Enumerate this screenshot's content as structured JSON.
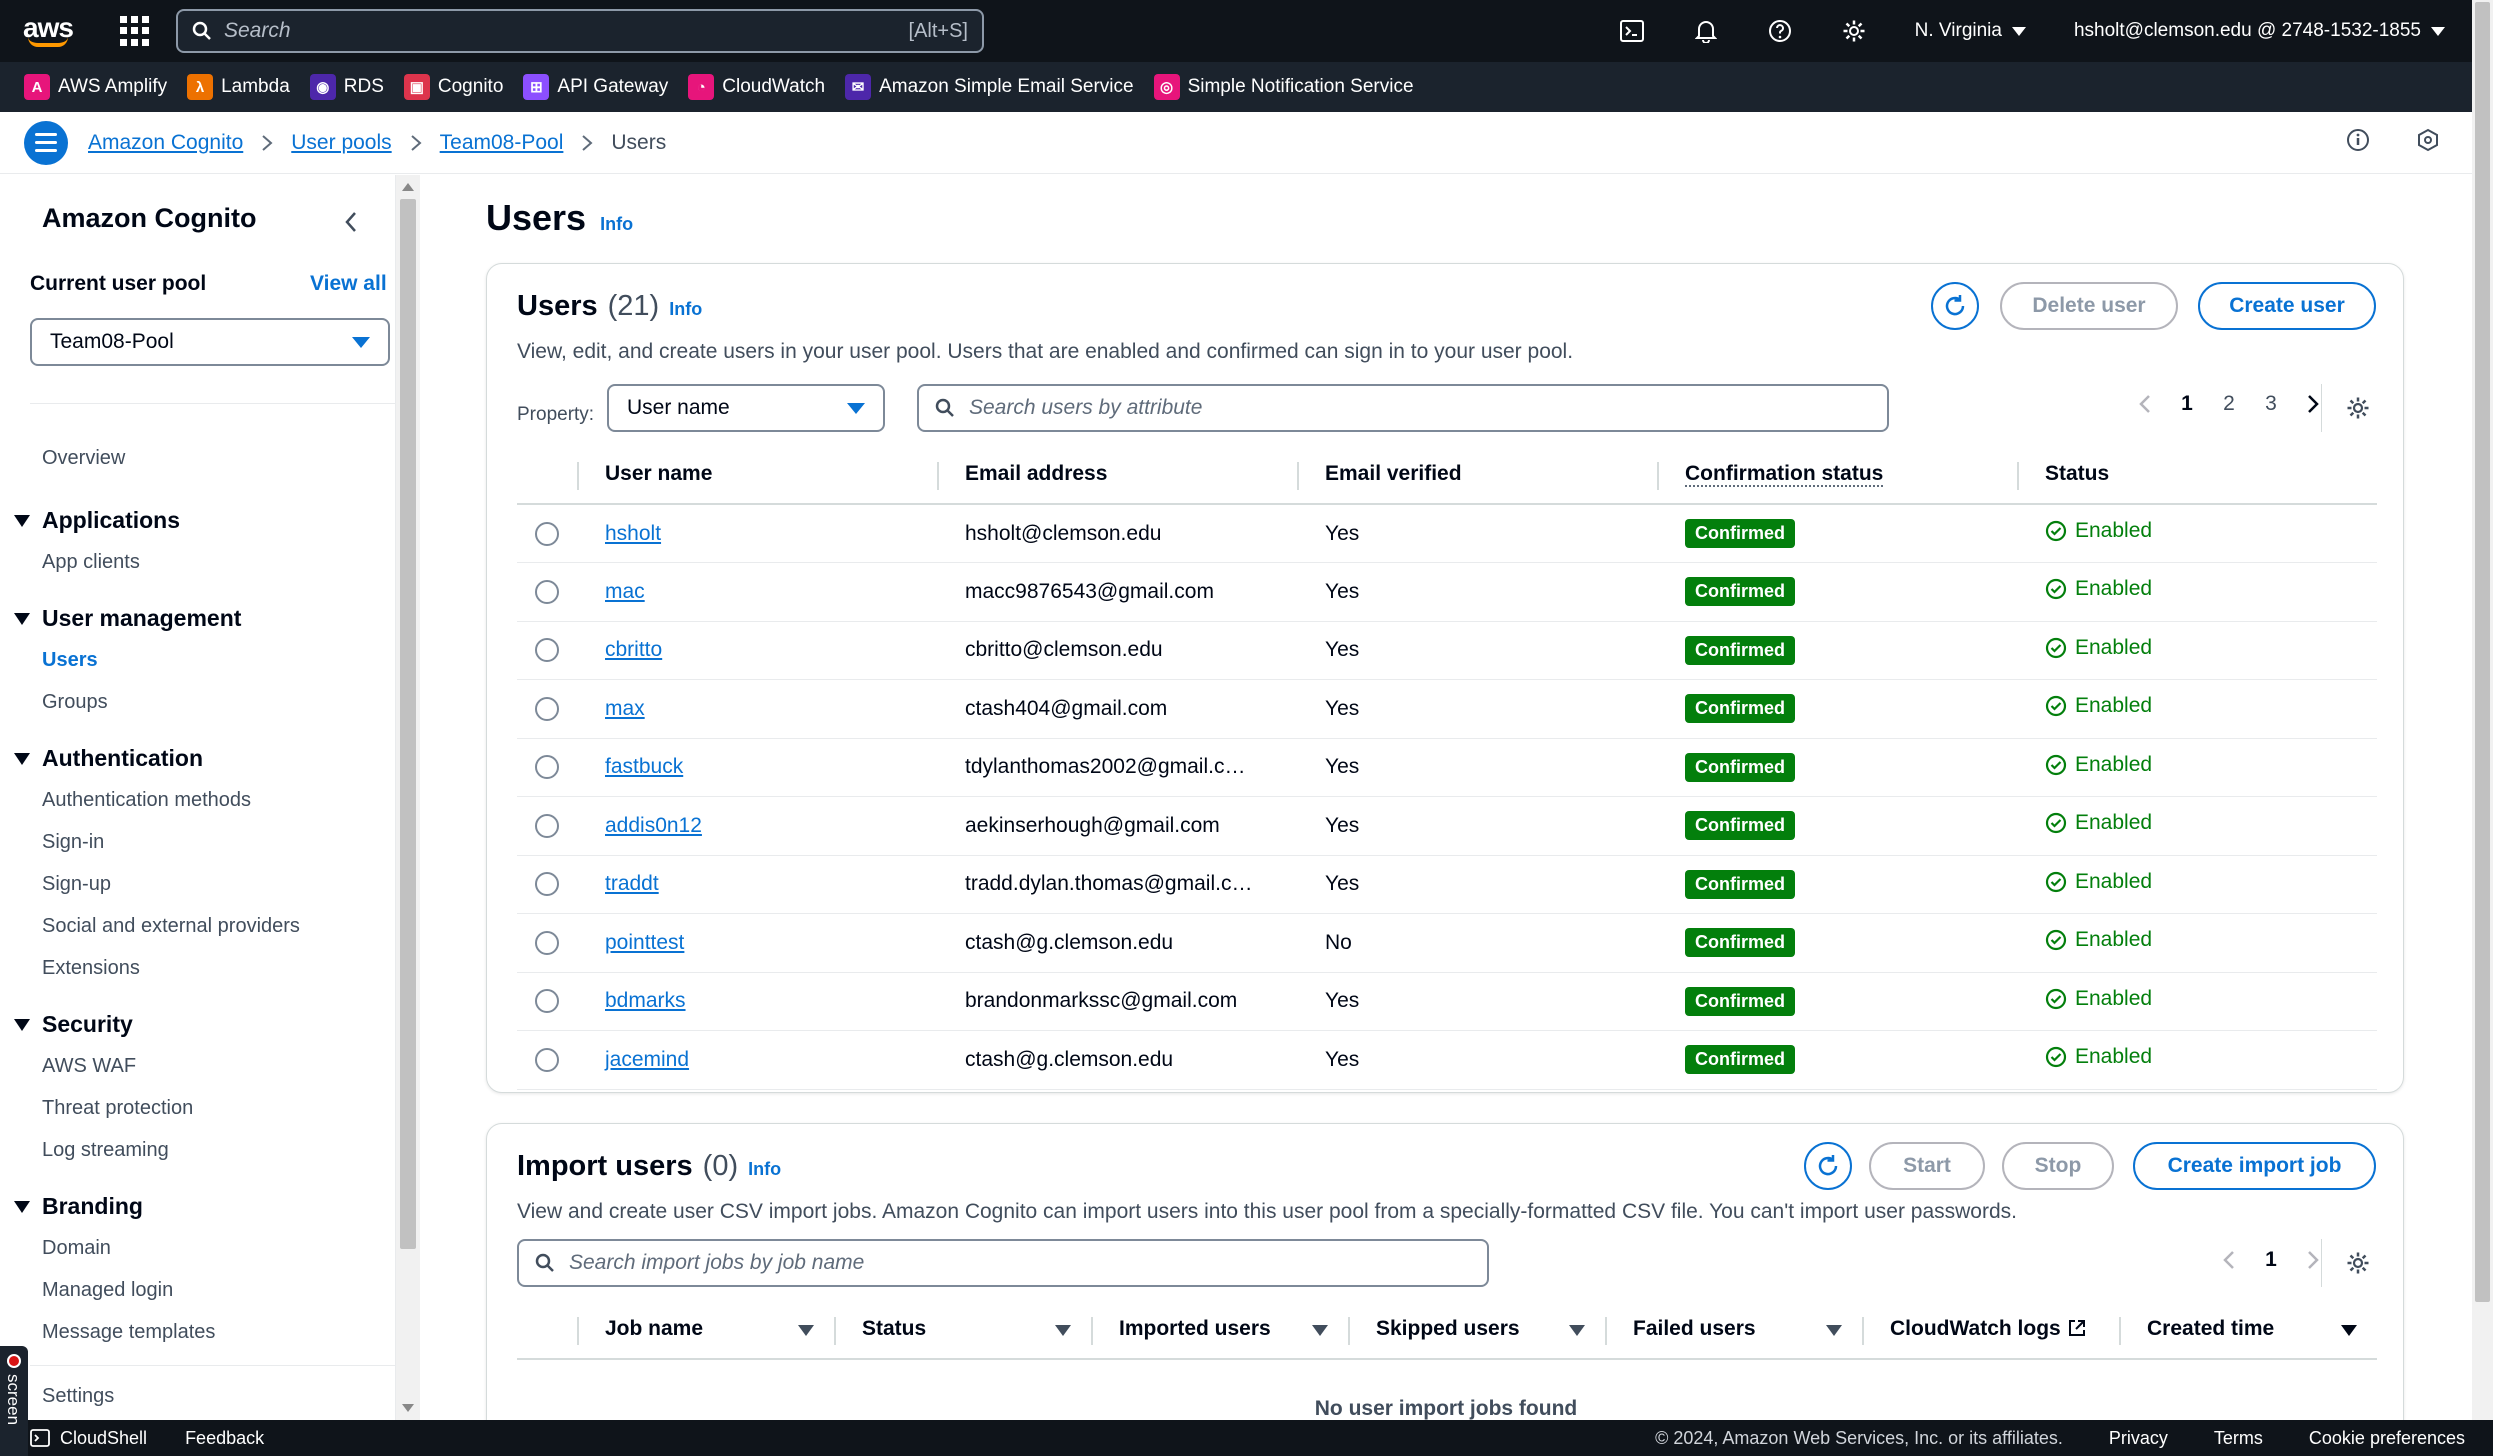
{
  "topnav": {
    "logo": "aws",
    "search_placeholder": "Search",
    "search_shortcut": "[Alt+S]",
    "region": "N. Virginia",
    "account": "hsholt@clemson.edu @ 2748-1532-1855",
    "icons": [
      "cloudshell-icon",
      "bell-icon",
      "help-icon",
      "gear-icon"
    ]
  },
  "favorites": [
    {
      "label": "AWS Amplify",
      "color": "#e7157b",
      "glyph": "A"
    },
    {
      "label": "Lambda",
      "color": "#ed7100",
      "glyph": "λ"
    },
    {
      "label": "RDS",
      "color": "#4d27aa",
      "glyph": "◉"
    },
    {
      "label": "Cognito",
      "color": "#dd344c",
      "glyph": "▣"
    },
    {
      "label": "API Gateway",
      "color": "#8c4fff",
      "glyph": "⊞"
    },
    {
      "label": "CloudWatch",
      "color": "#e7157b",
      "glyph": "◔"
    },
    {
      "label": "Amazon Simple Email Service",
      "color": "#4d27aa",
      "glyph": "✉"
    },
    {
      "label": "Simple Notification Service",
      "color": "#e7157b",
      "glyph": "◎"
    }
  ],
  "breadcrumbs": {
    "items": [
      "Amazon Cognito",
      "User pools",
      "Team08-Pool"
    ],
    "current": "Users"
  },
  "sidebar": {
    "title": "Amazon Cognito",
    "current_pool_label": "Current user pool",
    "view_all": "View all",
    "pool_value": "Team08-Pool",
    "overview": "Overview",
    "sections": [
      {
        "title": "Applications",
        "items": [
          "App clients"
        ]
      },
      {
        "title": "User management",
        "items": [
          "Users",
          "Groups"
        ]
      },
      {
        "title": "Authentication",
        "items": [
          "Authentication methods",
          "Sign-in",
          "Sign-up",
          "Social and external providers",
          "Extensions"
        ]
      },
      {
        "title": "Security",
        "items": [
          "AWS WAF",
          "Threat protection",
          "Log streaming"
        ]
      },
      {
        "title": "Branding",
        "items": [
          "Domain",
          "Managed login",
          "Message templates"
        ]
      }
    ],
    "settings": "Settings"
  },
  "main": {
    "page_title": "Users",
    "info": "Info",
    "users_card": {
      "title": "Users",
      "count": "(21)",
      "info": "Info",
      "description": "View, edit, and create users in your user pool. Users that are enabled and confirmed can sign in to your user pool.",
      "delete_label": "Delete user",
      "create_label": "Create user",
      "property_label": "Property:",
      "property_value": "User name",
      "search_placeholder": "Search users by attribute",
      "pages": [
        "1",
        "2",
        "3"
      ],
      "columns": [
        "User name",
        "Email address",
        "Email verified",
        "Confirmation status",
        "Status"
      ],
      "rows": [
        {
          "username": "hsholt",
          "email": "hsholt@clemson.edu",
          "verified": "Yes",
          "confirmation": "Confirmed",
          "status": "Enabled"
        },
        {
          "username": "mac",
          "email": "macc9876543@gmail.com",
          "verified": "Yes",
          "confirmation": "Confirmed",
          "status": "Enabled"
        },
        {
          "username": "cbritto",
          "email": "cbritto@clemson.edu",
          "verified": "Yes",
          "confirmation": "Confirmed",
          "status": "Enabled"
        },
        {
          "username": "max",
          "email": "ctash404@gmail.com",
          "verified": "Yes",
          "confirmation": "Confirmed",
          "status": "Enabled"
        },
        {
          "username": "fastbuck",
          "email": "tdylanthomas2002@gmail.c…",
          "verified": "Yes",
          "confirmation": "Confirmed",
          "status": "Enabled"
        },
        {
          "username": "addis0n12",
          "email": "aekinserhough@gmail.com",
          "verified": "Yes",
          "confirmation": "Confirmed",
          "status": "Enabled"
        },
        {
          "username": "traddt",
          "email": "tradd.dylan.thomas@gmail.c…",
          "verified": "Yes",
          "confirmation": "Confirmed",
          "status": "Enabled"
        },
        {
          "username": "pointtest",
          "email": "ctash@g.clemson.edu",
          "verified": "No",
          "confirmation": "Confirmed",
          "status": "Enabled"
        },
        {
          "username": "bdmarks",
          "email": "brandonmarkssc@gmail.com",
          "verified": "Yes",
          "confirmation": "Confirmed",
          "status": "Enabled"
        },
        {
          "username": "jacemind",
          "email": "ctash@g.clemson.edu",
          "verified": "Yes",
          "confirmation": "Confirmed",
          "status": "Enabled"
        }
      ]
    },
    "import_card": {
      "title": "Import users",
      "count": "(0)",
      "info": "Info",
      "description": "View and create user CSV import jobs. Amazon Cognito can import users into this user pool from a specially-formatted CSV file. You can't import user passwords.",
      "start_label": "Start",
      "stop_label": "Stop",
      "create_label": "Create import job",
      "search_placeholder": "Search import jobs by job name",
      "page": "1",
      "columns": [
        "Job name",
        "Status",
        "Imported users",
        "Skipped users",
        "Failed users",
        "CloudWatch logs",
        "Created time"
      ],
      "empty": "No user import jobs found"
    }
  },
  "footer": {
    "cloudshell": "CloudShell",
    "feedback": "Feedback",
    "copyright": "© 2024, Amazon Web Services, Inc. or its affiliates.",
    "privacy": "Privacy",
    "terms": "Terms",
    "cookies": "Cookie preferences",
    "recorder": "screen"
  },
  "colors": {
    "accent": "#0972d3",
    "success": "#037f0c",
    "nav_bg": "#0f141a",
    "fav_bg": "#1b232d"
  }
}
